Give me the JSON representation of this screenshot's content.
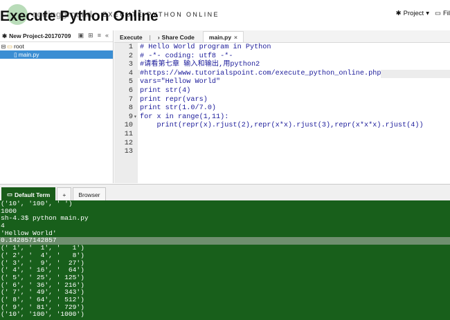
{
  "header": {
    "brand": "codingground",
    "tagline": "EXECUTE PYTHON ONLINE",
    "title": "Execute Python Online",
    "project_label": "Project",
    "file_label": "Fil"
  },
  "sidebar": {
    "project_name": "New Project-20170709",
    "tree": [
      {
        "label": "root",
        "type": "folder"
      },
      {
        "label": "main.py",
        "type": "file",
        "selected": true
      }
    ]
  },
  "editor": {
    "tabs": [
      {
        "label": "Execute"
      },
      {
        "label": "Share Code"
      },
      {
        "label": "main.py",
        "active": true,
        "close": "×"
      }
    ],
    "lines": [
      "# Hello World program in Python",
      "# -*- coding: utf8 -*-",
      "#请看第七章 输入和输出,用python2",
      "#https://www.tutorialspoint.com/execute_python_online.php",
      "vars=\"Hellow World\"",
      "print str(4)",
      "print repr(vars)",
      "print str(1.0/7.0)",
      "for x in range(1,11):",
      "    print(repr(x).rjust(2),repr(x*x).rjust(3),repr(x*x*x).rjust(4))",
      "",
      "",
      ""
    ],
    "active_line": 4
  },
  "terminal_tabs": {
    "default_term": "Default Term",
    "add": "+",
    "browser": "Browser"
  },
  "terminal": {
    "lines": [
      "('10', '100', ' ')",
      "1000",
      "sh-4.3$ python main.py",
      "4",
      "'Hellow World'",
      "0.142857142857",
      "(' 1', '  1', '   1')",
      "(' 2', '  4', '   8')",
      "(' 3', '  9', '  27')",
      "(' 4', ' 16', '  64')",
      "(' 5', ' 25', ' 125')",
      "(' 6', ' 36', ' 216')",
      "(' 7', ' 49', ' 343')",
      "(' 8', ' 64', ' 512')",
      "(' 9', ' 81', ' 729')",
      "('10', '100', '1000')"
    ],
    "highlight_line": 5
  },
  "colors": {
    "terminal_bg": "#185f1b",
    "selection": "#3b8ed3"
  }
}
